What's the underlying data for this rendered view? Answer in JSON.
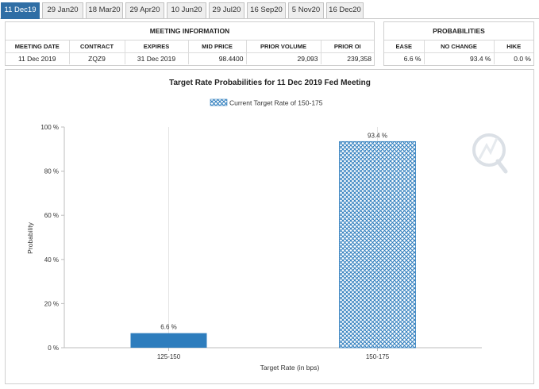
{
  "tabs": [
    {
      "label": "11 Dec19",
      "active": true
    },
    {
      "label": "29 Jan20",
      "active": false
    },
    {
      "label": "18 Mar20",
      "active": false
    },
    {
      "label": "29 Apr20",
      "active": false
    },
    {
      "label": "10 Jun20",
      "active": false
    },
    {
      "label": "29 Jul20",
      "active": false
    },
    {
      "label": "16 Sep20",
      "active": false
    },
    {
      "label": "5 Nov20",
      "active": false
    },
    {
      "label": "16 Dec20",
      "active": false
    }
  ],
  "meeting_info": {
    "title": "MEETING INFORMATION",
    "headers": [
      "MEETING DATE",
      "CONTRACT",
      "EXPIRES",
      "MID PRICE",
      "PRIOR VOLUME",
      "PRIOR OI"
    ],
    "values": [
      "11 Dec 2019",
      "ZQZ9",
      "31 Dec 2019",
      "98.4400",
      "29,093",
      "239,358"
    ]
  },
  "probabilities": {
    "title": "PROBABILITIES",
    "headers": [
      "EASE",
      "NO CHANGE",
      "HIKE"
    ],
    "values": [
      "6.6 %",
      "93.4 %",
      "0.0 %"
    ]
  },
  "colors": {
    "tab_active": "#2f6ea5",
    "bar_solid": "#2e7dbd",
    "bar_hatch": "#2e7dbd"
  },
  "chart_data": {
    "type": "bar",
    "title": "Target Rate Probabilities for 11 Dec 2019 Fed Meeting",
    "legend": "Current Target Rate of 150-175",
    "legend_position": "top-center",
    "xlabel": "Target Rate (in bps)",
    "ylabel": "Probability",
    "categories": [
      "125-150",
      "150-175"
    ],
    "values": [
      6.6,
      93.4
    ],
    "data_labels": [
      "6.6 %",
      "93.4 %"
    ],
    "current_category": "150-175",
    "ylim": [
      0,
      100
    ],
    "yticks": [
      0,
      20,
      40,
      60,
      80,
      100
    ],
    "ytick_labels": [
      "0 %",
      "20 %",
      "40 %",
      "60 %",
      "80 %",
      "100 %"
    ],
    "grid": "vertical"
  }
}
